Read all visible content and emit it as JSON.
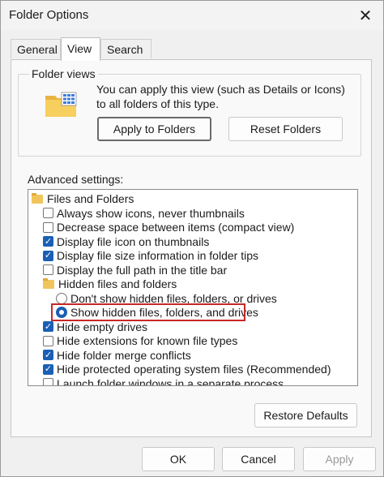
{
  "window": {
    "title": "Folder Options",
    "close_glyph": "✕"
  },
  "tabs": [
    {
      "label": "General"
    },
    {
      "label": "View"
    },
    {
      "label": "Search"
    }
  ],
  "folder_views": {
    "label": "Folder views",
    "description": "You can apply this view (such as Details or Icons) to all folders of this type.",
    "apply_label": "Apply to Folders",
    "reset_label": "Reset Folders"
  },
  "advanced": {
    "label": "Advanced settings:",
    "items": [
      {
        "kind": "folder",
        "label": "Files and Folders",
        "icon": "folder-icon"
      },
      {
        "kind": "checkbox",
        "checked": false,
        "label": "Always show icons, never thumbnails"
      },
      {
        "kind": "checkbox",
        "checked": false,
        "label": "Decrease space between items (compact view)"
      },
      {
        "kind": "checkbox",
        "checked": true,
        "label": "Display file icon on thumbnails"
      },
      {
        "kind": "checkbox",
        "checked": true,
        "label": "Display file size information in folder tips"
      },
      {
        "kind": "checkbox",
        "checked": false,
        "label": "Display the full path in the title bar"
      },
      {
        "kind": "folder",
        "label": "Hidden files and folders",
        "icon": "folder-icon"
      },
      {
        "kind": "radio",
        "checked": false,
        "label": "Don't show hidden files, folders, or drives"
      },
      {
        "kind": "radio",
        "checked": true,
        "label": "Show hidden files, folders, and drives"
      },
      {
        "kind": "checkbox",
        "checked": true,
        "label": "Hide empty drives"
      },
      {
        "kind": "checkbox",
        "checked": false,
        "label": "Hide extensions for known file types"
      },
      {
        "kind": "checkbox",
        "checked": true,
        "label": "Hide folder merge conflicts"
      },
      {
        "kind": "checkbox",
        "checked": true,
        "label": "Hide protected operating system files (Recommended)"
      },
      {
        "kind": "checkbox",
        "checked": false,
        "label": "Launch folder windows in a separate process"
      }
    ],
    "restore_label": "Restore Defaults"
  },
  "footer": {
    "ok_label": "OK",
    "cancel_label": "Cancel",
    "apply_label": "Apply"
  },
  "colors": {
    "accent": "#1a5fb4",
    "highlight_box": "#c62828"
  }
}
